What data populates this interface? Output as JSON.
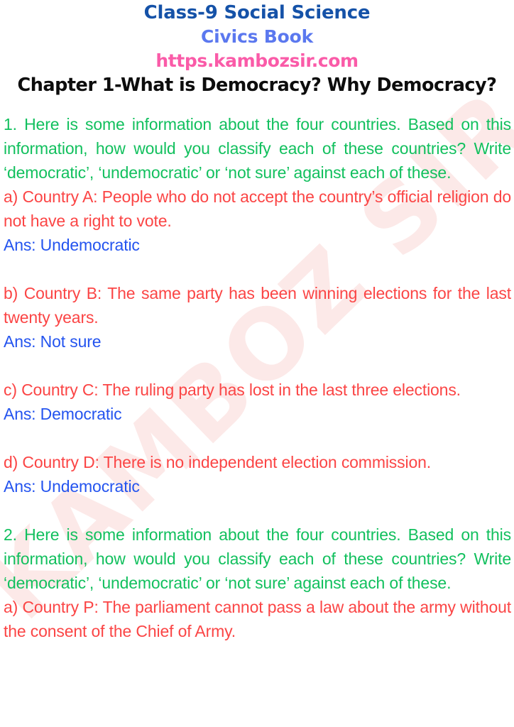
{
  "document": {
    "background_color": "#ffffff",
    "watermark": {
      "text": "KAMBOZ SIR",
      "color": "#fce9e8",
      "rotation_deg": -44
    },
    "header": {
      "class_line": "Class-9  Social Science",
      "class_line_color": "#1552a8",
      "book_line": "Civics Book",
      "book_line_color": "#5b78ef",
      "url_line": "https.kambozsir.com",
      "url_line_color": "#fa5ba8",
      "chapter_line": "Chapter 1-What is Democracy? Why Democracy?",
      "chapter_line_color": "#0d0d0d"
    },
    "colors": {
      "question_stem": "#12c05e",
      "sub_question": "#fb4545",
      "answer": "#2454ef"
    },
    "questions": [
      {
        "number": "1.",
        "stem": "1. Here is some information about the four countries. Based on this information, how would you classify each of these countries? Write ‘democratic’, ‘undemocratic’ or ‘not sure’ against each of these.",
        "items": [
          {
            "prompt": "a) Country A: People who do not accept the country’s official religion do not have a right to vote.",
            "answer": "Ans: Undemocratic"
          },
          {
            "prompt": "b) Country B: The same party has been winning elections for the last twenty years.",
            "answer": "Ans: Not sure"
          },
          {
            "prompt": "c) Country C: The ruling party has lost in the last three elections.",
            "answer": "Ans: Democratic"
          },
          {
            "prompt": "d) Country D: There is no independent election commission.",
            "answer": "Ans: Undemocratic"
          }
        ]
      },
      {
        "number": "2.",
        "stem": "2. Here is some information about the four countries. Based on this information, how would you classify each of these countries? Write ‘democratic’, ‘undemocratic’ or ‘not sure’ against each of these.",
        "items": [
          {
            "prompt": "a) Country P: The parliament cannot pass a law about the army without the consent of the Chief of Army.",
            "answer": ""
          }
        ]
      }
    ]
  }
}
